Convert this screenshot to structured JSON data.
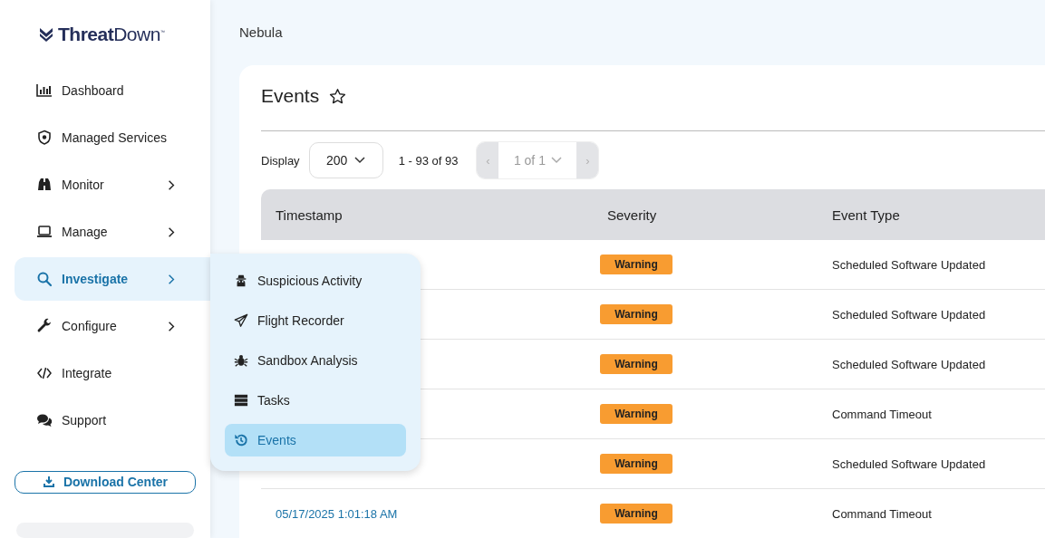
{
  "logo": "**Threat**Down$^{™}$",
  "nav": [
    {
      "label": "Dashboard",
      "selected": false,
      "expandable": false
    },
    {
      "label": "Managed Services",
      "selected": false,
      "expandable": false
    },
    {
      "label": "Monitor",
      "selected": false,
      "expandable": true
    },
    {
      "label": "Manage",
      "selected": false,
      "expandable": true
    },
    {
      "label": "Investigate",
      "selected": true,
      "expandable": true
    },
    {
      "label": "Configure",
      "selected": false,
      "expandable": true
    },
    {
      "label": "Integrate",
      "selected": false,
      "expandable": false
    },
    {
      "label": "Support",
      "selected": false,
      "expandable": false
    }
  ],
  "download_button": "Download Center",
  "breadcrumb": "Nebula",
  "page_title": "Events",
  "favorite": false,
  "toolbar": {
    "display_label": "Display",
    "page_size": "200",
    "range": "1 - 93 of 93",
    "prev": {
      "label": "‹",
      "disabled": true
    },
    "page": "1 of 1",
    "next": {
      "label": "›",
      "disabled": true
    }
  },
  "table": {
    "columns": [
      "Timestamp",
      "Severity",
      "Event Type"
    ],
    "rows": [
      {
        "severity": "Warning",
        "event_type": "Scheduled Software Updated"
      },
      {
        "severity": "Warning",
        "event_type": "Scheduled Software Updated"
      },
      {
        "severity": "Warning",
        "event_type": "Scheduled Software Updated"
      },
      {
        "severity": "Warning",
        "event_type": "Command Timeout"
      },
      {
        "severity": "Warning",
        "event_type": "Scheduled Software Updated"
      },
      {
        "timestamp": "05/17/2025 1:01:18 AM",
        "severity": "Warning",
        "event_type": "Command Timeout"
      }
    ]
  },
  "submenu": [
    {
      "label": "Suspicious Activity",
      "selected": false
    },
    {
      "label": "Flight Recorder",
      "selected": false
    },
    {
      "label": "Sandbox Analysis",
      "selected": false
    },
    {
      "label": "Tasks",
      "selected": false
    },
    {
      "label": "Events",
      "selected": true
    }
  ]
}
